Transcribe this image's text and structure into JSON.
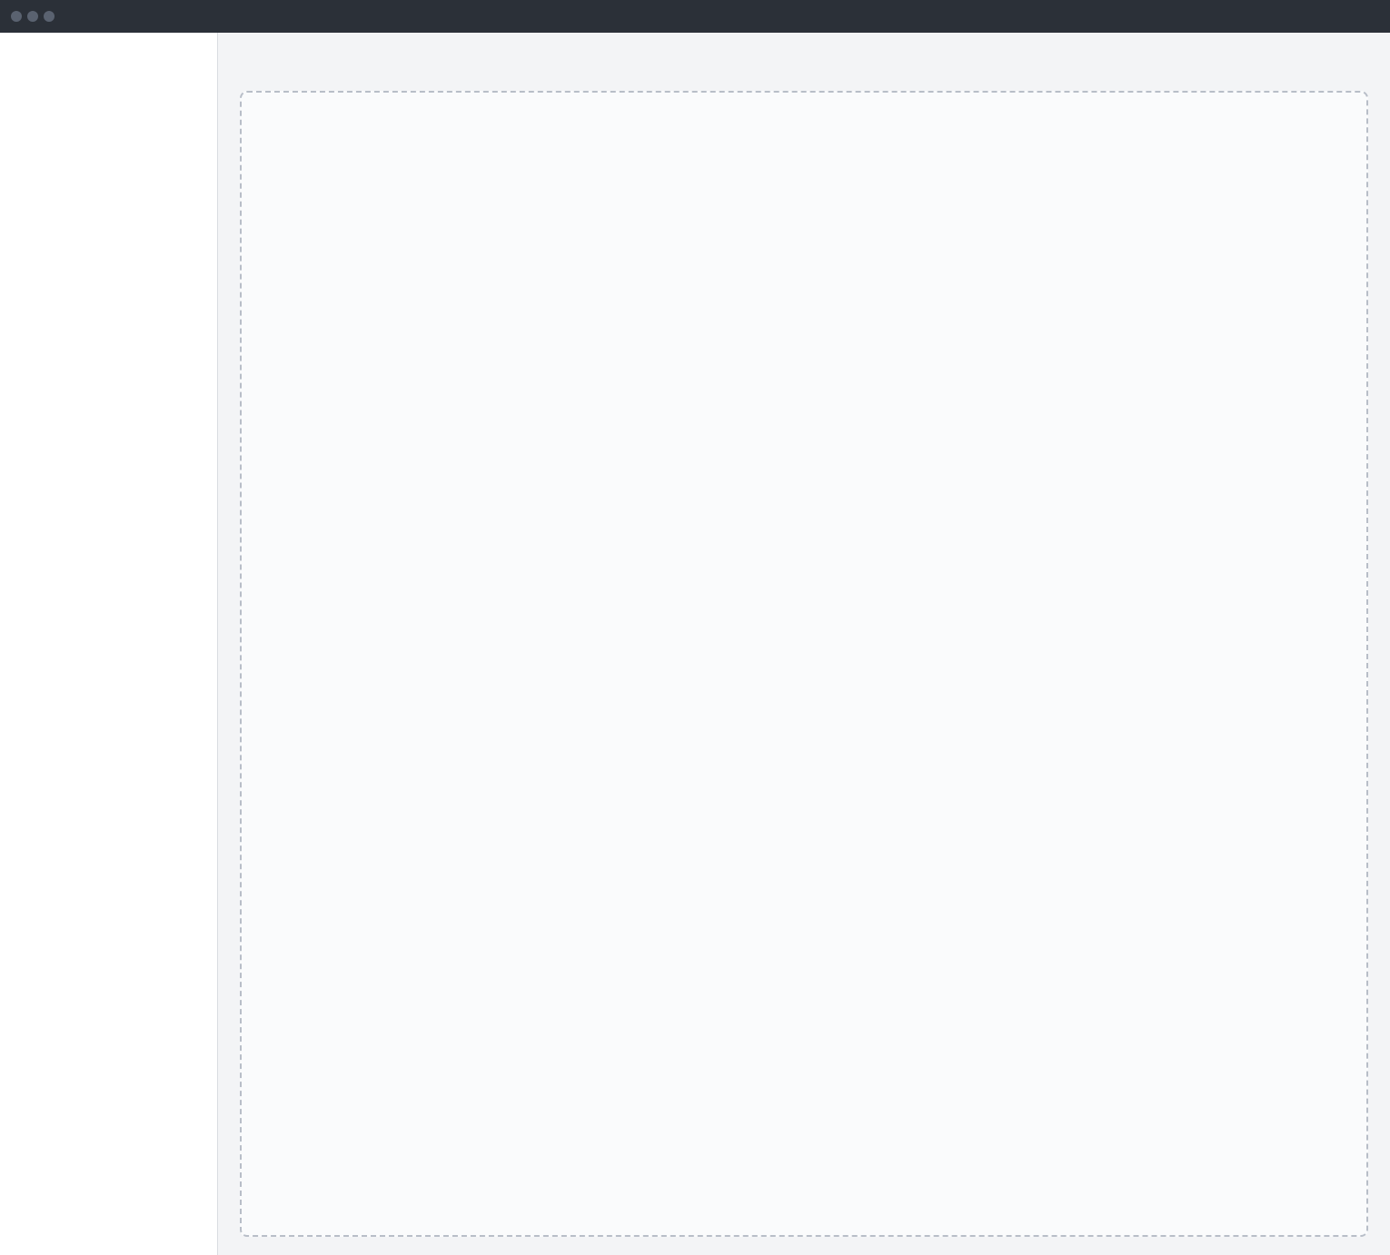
{
  "window": {
    "title": ""
  },
  "sidebar": {
    "items": []
  },
  "main": {
    "page_title": ""
  },
  "notice": {
    "text": ""
  }
}
